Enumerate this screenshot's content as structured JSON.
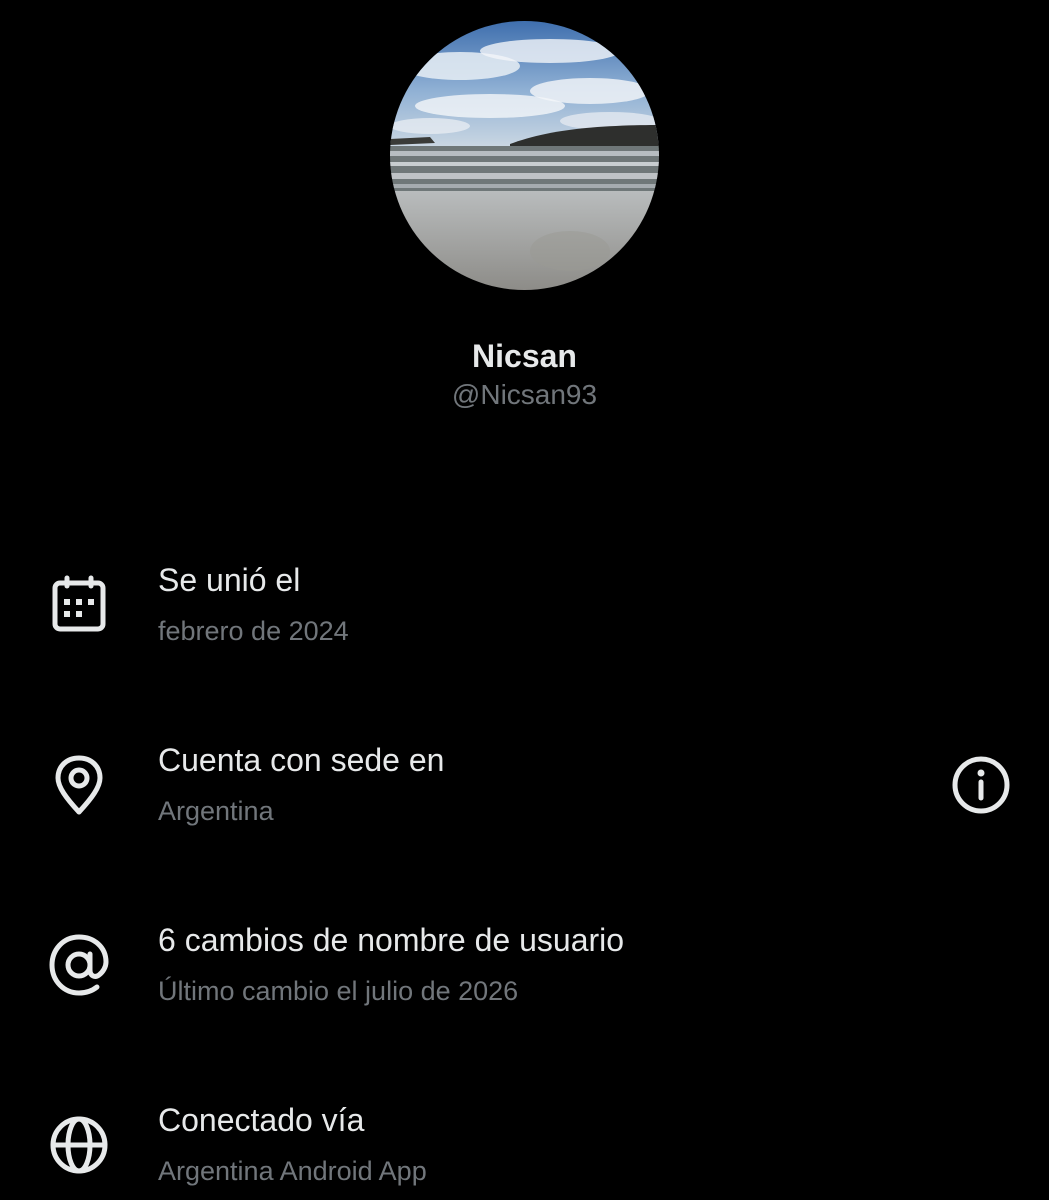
{
  "profile": {
    "display_name": "Nicsan",
    "handle": "@Nicsan93"
  },
  "rows": [
    {
      "icon": "calendar-icon",
      "title": "Se unió el",
      "subtitle": "febrero de 2024"
    },
    {
      "icon": "location-pin-icon",
      "title": "Cuenta con sede en",
      "subtitle": "Argentina",
      "action_icon": "info-icon"
    },
    {
      "icon": "at-sign-icon",
      "title": "6 cambios de nombre de usuario",
      "subtitle": "Último cambio el julio de 2026"
    },
    {
      "icon": "globe-icon",
      "title": "Conectado vía",
      "subtitle": "Argentina Android App"
    }
  ],
  "colors": {
    "background": "#000000",
    "primary_text": "#e7e9ea",
    "secondary_text": "#71767b",
    "icon": "#e7e9ea"
  }
}
